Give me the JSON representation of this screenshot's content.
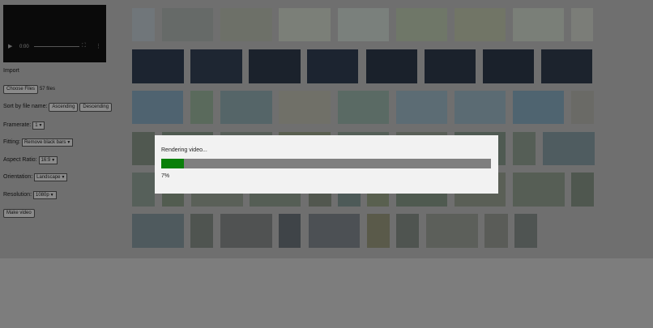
{
  "video": {
    "time": "0:00"
  },
  "import": {
    "heading": "Import",
    "choose_files": "Choose Files",
    "file_count": "57 files"
  },
  "sort": {
    "label": "Sort by file name:",
    "ascending": "Ascending",
    "descending": "Descending"
  },
  "framerate": {
    "label": "Framerate:",
    "value": "1"
  },
  "fitting": {
    "label": "Fitting:",
    "value": "Remove black bars"
  },
  "aspect_ratio": {
    "label": "Aspect Ratio:",
    "value": "16:9"
  },
  "orientation": {
    "label": "Orientation:",
    "value": "Landscape"
  },
  "resolution": {
    "label": "Resolution:",
    "value": "1080p"
  },
  "make_video": "Make video",
  "modal": {
    "message": "Rendering video...",
    "percent_label": "7%",
    "progress": 0.07
  },
  "colors": {
    "progress_fill": "#0a7f0a",
    "progress_track": "#7f7f7f",
    "modal_bg": "#f2f2f2",
    "overlay": "#6f6f6f"
  },
  "thumbnails": [
    [
      "#70767a",
      "#666a68",
      "#6d7068",
      "#7b7f78",
      "#7a807c",
      "#6f7768",
      "#717566",
      "#7a7f78",
      "#7b7d78"
    ],
    [
      "#1c2430",
      "#1e2632",
      "#1b222c",
      "#1c2430",
      "#1a212b",
      "#1b222c",
      "#1a212b",
      "#1c232d"
    ],
    [
      "#4f6370",
      "#5a6a5c",
      "#556568",
      "#707068",
      "#5a6a64",
      "#5c6c74",
      "#5b6b73",
      "#4f6470",
      "#6a6a66"
    ],
    [
      "#505850",
      "#4f5a50",
      "#575f58",
      "#5a6050",
      "#556058",
      "#5a6058",
      "#4f5a52",
      "#555e56",
      "#4f5c60"
    ],
    [
      "#56605a",
      "#525c50",
      "#5a6058",
      "#555e55",
      "#52574f",
      "#4d5a58",
      "#59604f",
      "#4f5a50",
      "#5a5f56",
      "#565e55",
      "#4f574f"
    ],
    [
      "#4f5a5e",
      "#4f5450",
      "#505252",
      "#3f4448",
      "#4c5054",
      "#5a5a4a",
      "#4f5450",
      "#5c5f5a",
      "#5a5c58",
      "#4f5452"
    ]
  ]
}
